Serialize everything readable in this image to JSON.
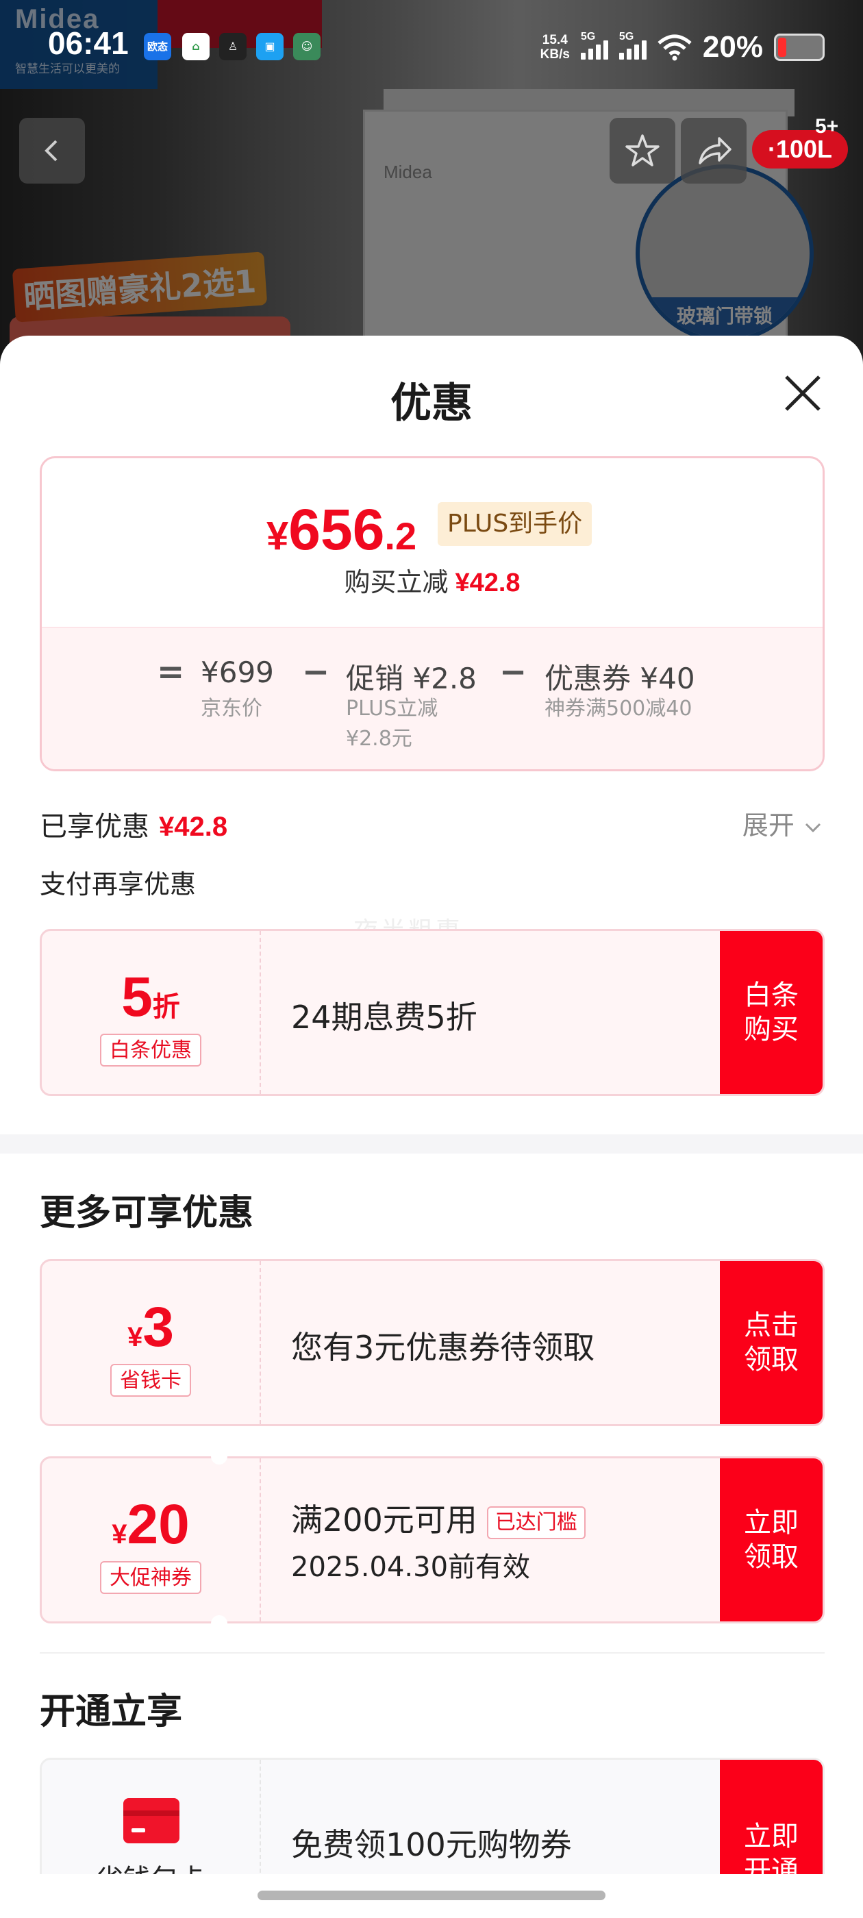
{
  "status_bar": {
    "time": "06:41",
    "net_speed_value": "15.4",
    "net_speed_unit": "KB/s",
    "signal1_label": "5G",
    "signal2_label": "5G",
    "battery_pct": "20%",
    "battery_level": 0.2,
    "apps": [
      "欧态",
      "home",
      "user",
      "window",
      "avatar"
    ]
  },
  "background": {
    "brand": "Midea",
    "slogan": "智慧生活可以更美的",
    "promo_banner": "晒图赠豪礼2选1",
    "fridge_logo": "Midea",
    "detail_label": "玻璃门带锁",
    "cart_badge": "·100L",
    "cart_count": "5+"
  },
  "sheet": {
    "title": "优惠",
    "summary": {
      "price_symbol": "¥",
      "price_integer": "656",
      "price_decimal": ".2",
      "plus_tag": "PLUS到手价",
      "reduce_label": "购买立减",
      "reduce_amount": "¥42.8",
      "equals": "=",
      "jd_price": "¥699",
      "jd_price_label": "京东价",
      "minus1": "−",
      "promo_label": "促销",
      "promo_amount": "¥2.8",
      "promo_sub_1": "PLUS立减",
      "promo_sub_2": "¥2.8元",
      "minus2": "−",
      "coupon_label": "优惠券",
      "coupon_amount": "¥40",
      "coupon_sub": "神券满500减40"
    },
    "enjoyed_label": "已享优惠",
    "enjoyed_amount": "¥42.8",
    "expand_label": "展开",
    "pay_title": "支付再享优惠",
    "watermark": "夜半粗惠",
    "baitiao": {
      "value_big": "5",
      "value_small": "折",
      "tag": "白条优惠",
      "desc": "24期息费5折",
      "button": "白条购买"
    },
    "more_title": "更多可享优惠",
    "card_3": {
      "symbol": "¥",
      "value": "3",
      "tag": "省钱卡",
      "desc": "您有3元优惠券待领取",
      "button": "点击领取"
    },
    "card_20": {
      "symbol": "¥",
      "value": "20",
      "tag": "大促神券",
      "desc": "满200元可用",
      "reach_tag": "已达门槛",
      "expire": "2025.04.30前有效",
      "button": "立即领取"
    },
    "open_title": "开通立享",
    "card_open": {
      "tag": "省钱包卡",
      "desc": "免费领100元购物券",
      "button": "立即开通"
    }
  },
  "colors": {
    "accent_red": "#f0091f",
    "button_red": "#fb0019",
    "plus_tag_bg": "#fdeed6"
  }
}
